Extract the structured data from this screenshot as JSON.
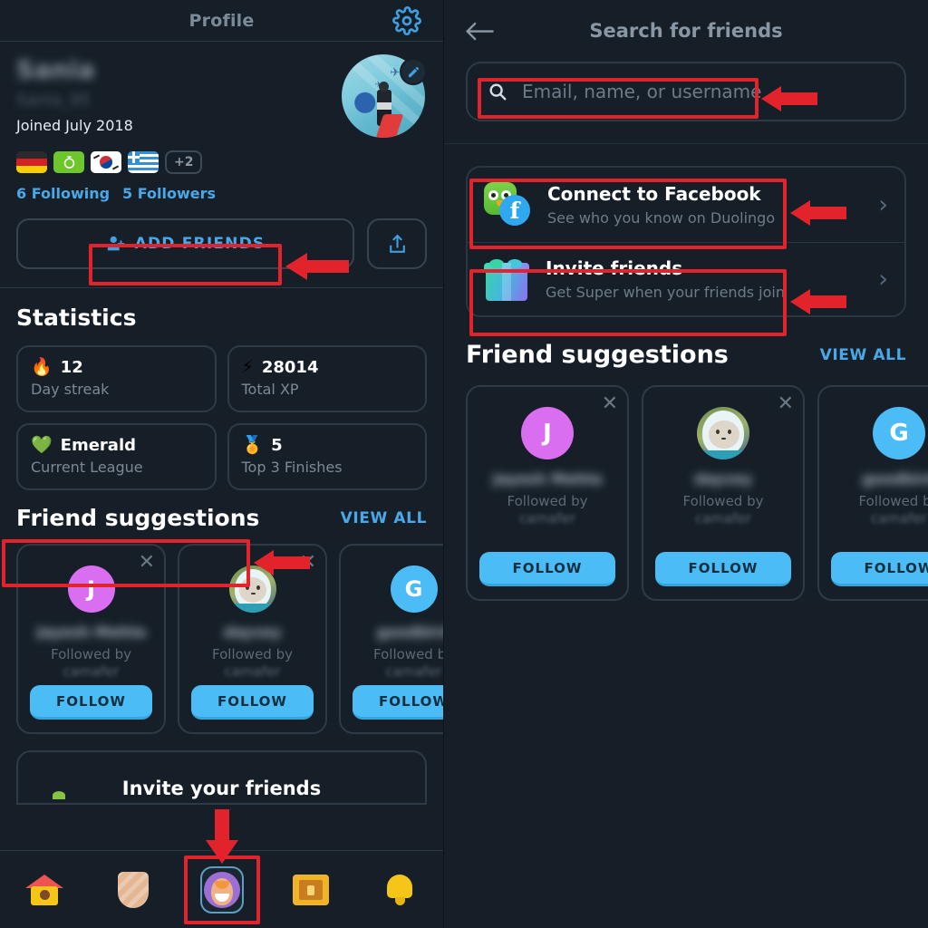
{
  "left": {
    "header": {
      "title": "Profile",
      "gear_icon": "gear-icon"
    },
    "profile": {
      "name_blurred": "Sania",
      "handle_blurred": "Sania_95",
      "joined": "Joined July 2018",
      "flags": [
        "flag-germany",
        "flag-esperanto",
        "flag-korea",
        "flag-greece"
      ],
      "flags_more": "+2",
      "following": "6 Following",
      "followers": "5 Followers",
      "edit_icon": "pencil-icon"
    },
    "actions": {
      "add_friends_label": "ADD FRIENDS",
      "add_friends_icon": "person-plus-icon",
      "share_icon": "share-icon"
    },
    "statistics": {
      "title": "Statistics",
      "cards": [
        {
          "icon": "flame-icon",
          "value": "12",
          "label": "Day streak"
        },
        {
          "icon": "lightning-icon",
          "value": "28014",
          "label": "Total XP"
        },
        {
          "icon": "gem-icon",
          "value": "Emerald",
          "label": "Current League"
        },
        {
          "icon": "medal-icon",
          "value": "5",
          "label": "Top 3 Finishes"
        }
      ]
    },
    "suggestions": {
      "title": "Friend suggestions",
      "view_all": "VIEW ALL",
      "close_icon": "close-icon",
      "cards": [
        {
          "avatar_letter": "J",
          "avatar_color": "#d96ff0",
          "name_blurred": "Jayesh Mehta...",
          "followed_by": "Followed by",
          "follower": "camafer",
          "follow_label": "FOLLOW"
        },
        {
          "avatar_letter": "",
          "avatar_color": "",
          "name_blurred": "dayvey",
          "followed_by": "Followed by",
          "follower": "camafer",
          "follow_label": "FOLLOW"
        },
        {
          "avatar_letter": "G",
          "avatar_color": "#4bbcf5",
          "name_blurred": "goodbird",
          "followed_by": "Followed by",
          "follower": "camafer",
          "follow_label": "FOLLOW"
        }
      ]
    },
    "invite": {
      "title": "Invite your friends"
    },
    "bottom_nav": [
      {
        "name": "nav-learn",
        "icon": "house-icon",
        "active": false
      },
      {
        "name": "nav-leaderboard",
        "icon": "shield-icon",
        "active": false
      },
      {
        "name": "nav-profile",
        "icon": "profile-avatar-icon",
        "active": true
      },
      {
        "name": "nav-quests",
        "icon": "treasure-chest-icon",
        "active": false
      },
      {
        "name": "nav-notifications",
        "icon": "bell-icon",
        "active": false
      }
    ]
  },
  "right": {
    "header": {
      "title": "Search for friends",
      "back_icon": "back-arrow-icon"
    },
    "search": {
      "placeholder": "Email, name, or username",
      "icon": "search-icon",
      "value": ""
    },
    "links": [
      {
        "title": "Connect to Facebook",
        "subtitle": "See who you know on Duolingo",
        "icon": "duolingo-facebook-icon",
        "chevron": "chevron-right-icon"
      },
      {
        "title": "Invite friends",
        "subtitle": "Get Super when your friends join",
        "icon": "gift-icon",
        "chevron": "chevron-right-icon"
      }
    ],
    "suggestions": {
      "title": "Friend suggestions",
      "view_all": "VIEW ALL",
      "close_icon": "close-icon",
      "cards": [
        {
          "avatar_letter": "J",
          "avatar_color": "#d96ff0",
          "name_blurred": "Jayesh Mehta...",
          "followed_by": "Followed by",
          "follower": "camafer",
          "follow_label": "FOLLOW"
        },
        {
          "avatar_letter": "",
          "avatar_color": "",
          "name_blurred": "dayvey",
          "followed_by": "Followed by",
          "follower": "camafer",
          "follow_label": "FOLLOW"
        },
        {
          "avatar_letter": "G",
          "avatar_color": "#4bbcf5",
          "name_blurred": "goodbird",
          "followed_by": "Followed by",
          "follower": "camafer",
          "follow_label": "FOLLOW"
        }
      ]
    }
  },
  "annotations": {
    "color": "#e3232b",
    "highlight_boxes": [
      "add-friends-button",
      "friend-suggestions-heading",
      "nav-profile-tab",
      "search-input",
      "connect-to-facebook-row",
      "invite-friends-row"
    ],
    "arrows": [
      "arrow-to-add-friends",
      "arrow-to-friend-suggestions",
      "arrow-down-to-profile-tab",
      "arrow-to-search-input",
      "arrow-to-facebook-row",
      "arrow-to-invite-row"
    ]
  }
}
